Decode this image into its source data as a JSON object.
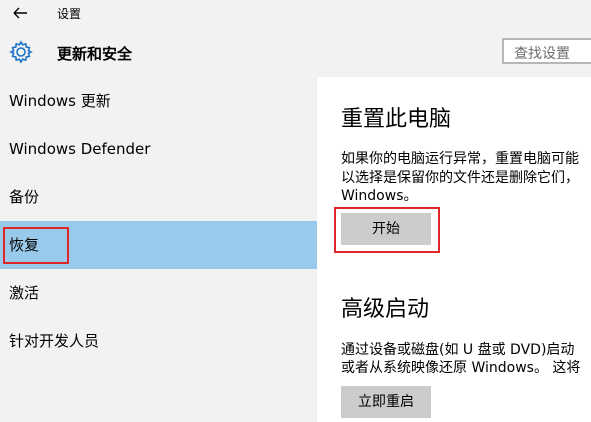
{
  "window": {
    "title": "设置",
    "back_icon": "back-arrow-icon"
  },
  "header": {
    "icon": "gear-icon",
    "title": "更新和安全",
    "search_placeholder": "查找设置"
  },
  "sidebar": {
    "items": [
      {
        "label": "Windows 更新",
        "selected": false
      },
      {
        "label": "Windows Defender",
        "selected": false
      },
      {
        "label": "备份",
        "selected": false
      },
      {
        "label": "恢复",
        "selected": true
      },
      {
        "label": "激活",
        "selected": false
      },
      {
        "label": "针对开发人员",
        "selected": false
      }
    ]
  },
  "main": {
    "reset": {
      "title": "重置此电脑",
      "desc_line1": "如果你的电脑运行异常，重置电脑可能",
      "desc_line2": "以选择是保留你的文件还是删除它们，",
      "desc_line3": "Windows。",
      "button": "开始"
    },
    "advanced": {
      "title": "高级启动",
      "desc_line1": "通过设备或磁盘(如 U 盘或 DVD)启动",
      "desc_line2": "或者从系统映像还原 Windows。 这将",
      "button": "立即重启"
    }
  },
  "colors": {
    "selected_bg": "#99c9eb",
    "highlight_box": "#e0262a",
    "button_bg": "#cccccc",
    "chrome_bg": "#f2f2f2"
  }
}
